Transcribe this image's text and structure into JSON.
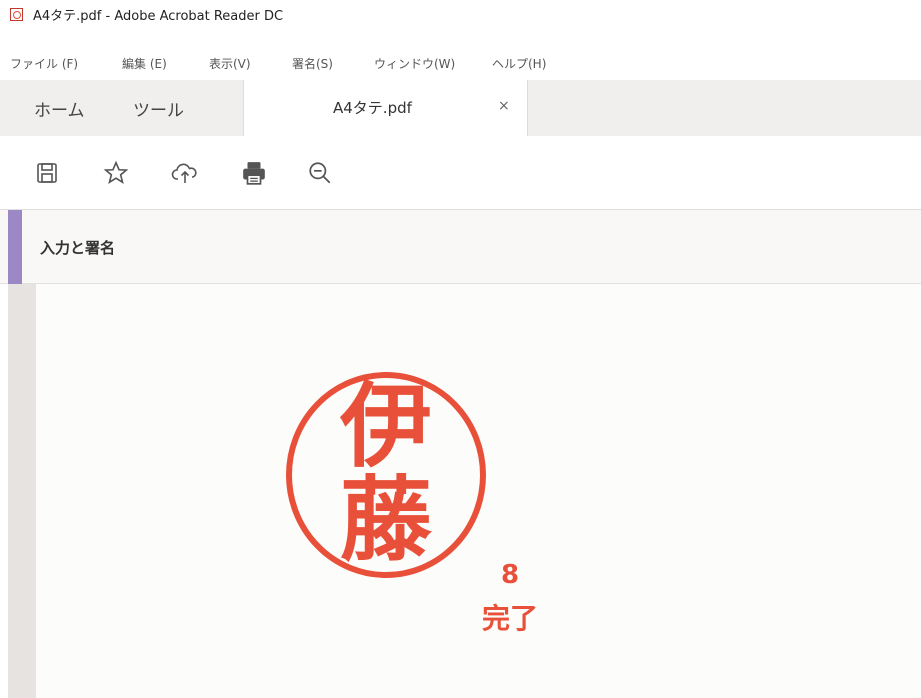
{
  "window": {
    "title": "A4タテ.pdf - Adobe Acrobat Reader DC"
  },
  "menu": {
    "items": [
      {
        "label": "ファイル (F)"
      },
      {
        "label": "編集 (E)"
      },
      {
        "label": "表示(V)"
      },
      {
        "label": "署名(S)"
      },
      {
        "label": "ウィンドウ(W)"
      },
      {
        "label": "ヘルプ(H)"
      }
    ]
  },
  "tabs": {
    "home": "ホーム",
    "tools": "ツール",
    "document": "A4タテ.pdf",
    "close": "×"
  },
  "toolbar": {
    "icons": [
      "save-icon",
      "star-icon",
      "cloud-upload-icon",
      "print-icon",
      "zoom-out-icon"
    ]
  },
  "panel": {
    "title": "入力と署名"
  },
  "stamp": {
    "line1": "伊",
    "line2": "藤",
    "color": "#e8503a"
  },
  "annotation": {
    "step": "8",
    "label": "完了"
  },
  "colors": {
    "accent": "#9b88c4",
    "stamp": "#e8503a"
  }
}
